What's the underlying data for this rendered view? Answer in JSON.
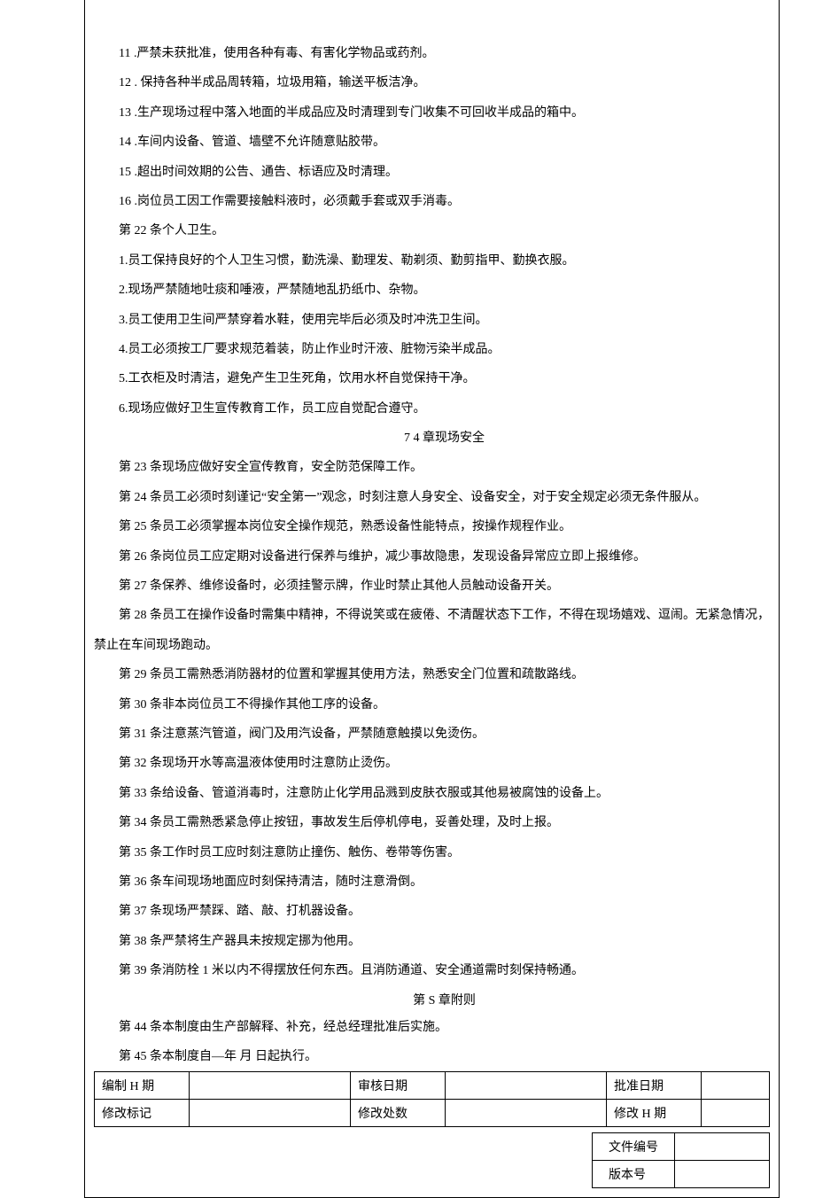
{
  "lines": {
    "l11": "11 .严禁未获批准，使用各种有毒、有害化学物品或药剂。",
    "l12": "12 . 保持各种半成品周转箱，垃圾用箱，输送平板洁净。",
    "l13": "13 .生产现场过程中落入地面的半成品应及时清理到专门收集不可回收半成品的箱中。",
    "l14": "14 .车间内设备、管道、墙壁不允许随意贴胶带。",
    "l15": "15 .超出时间效期的公告、通告、标语应及时清理。",
    "l16": "16 .岗位员工因工作需要接触料液时，必须戴手套或双手消毒。",
    "a22": "第 22 条个人卫生。",
    "p1": "1.员工保持良好的个人卫生习惯，勤洗澡、勤理发、勒剃须、勤剪指甲、勤换衣服。",
    "p2": "2.现场严禁随地吐痰和唾液，严禁随地乱扔纸巾、杂物。",
    "p3": "3.员工使用卫生间严禁穿着水鞋，使用完毕后必须及时冲洗卫生间。",
    "p4": "4.员工必须按工厂要求规范着装，防止作业时汗液、脏物污染半成品。",
    "p5": "5.工衣柜及时清洁，避免产生卫生死角，饮用水杯自觉保持干净。",
    "p6": "6.现场应做好卫生宣传教育工作，员工应自觉配合遵守。",
    "h4": "7  4 章现场安全",
    "a23": "第 23 条现场应做好安全宣传教育，安全防范保障工作。",
    "a24": "第 24 条员工必须时刻谨记“安全第一”观念，时刻注意人身安全、设备安全，对于安全规定必须无条件服从。",
    "a25": "第 25 条员工必须掌握本岗位安全操作规范，熟悉设备性能特点，按操作规程作业。",
    "a26": "第 26 条岗位员工应定期对设备进行保养与维护，减少事故隐患，发现设备异常应立即上报维修。",
    "a27": "第 27 条保养、维修设备时，必须挂警示牌，作业时禁止其他人员触动设备开关。",
    "a28a": "第 28 条员工在操作设备时需集中精神，不得说笑或在疲倦、不清醒状态下工作，不得在现场嬉戏、逗闹。无紧急情况，",
    "a28b": "禁止在车间现场跑动。",
    "a29": "第 29 条员工需熟悉消防器材的位置和掌握其使用方法，熟悉安全门位置和疏散路线。",
    "a30": "第 30 条非本岗位员工不得操作其他工序的设备。",
    "a31": "第 31 条注意蒸汽管道，阀门及用汽设备，严禁随意触摸以免烫伤。",
    "a32": "第 32 条现场开水等高温液体使用时注意防止烫伤。",
    "a33": "第 33 条给设备、管道消毒时，注意防止化学用品溅到皮肤衣服或其他易被腐蚀的设备上。",
    "a34": "第 34 条员工需熟悉紧急停止按钮，事故发生后停机停电，妥善处理，及时上报。",
    "a35": "第 35 条工作时员工应时刻注意防止撞伤、触伤、卷带等伤害。",
    "a36": "第 36 条车间现场地面应时刻保持清洁，随时注意滑倒。",
    "a37": "第 37 条现场严禁踩、踏、敲、打机器设备。",
    "a38": "第 38 条严禁将生产器具未按规定挪为他用。",
    "a39": "第 39 条消防栓 1 米以内不得摆放任何东西。且消防通道、安全通道需时刻保持畅通。",
    "hS": "第 S 章附则",
    "a44": "第 44 条本制度由生产部解释、补充，经总经理批准后实施。",
    "a45": "第 45 条本制度自—年  月  日起执行。"
  },
  "table1": {
    "r1c1": "编制 H 期",
    "r1c2": "",
    "r1c3": "审核日期",
    "r1c4": "",
    "r1c5": "批准日期",
    "r1c6": "",
    "r2c1": "修改标记",
    "r2c2": "",
    "r2c3": "修改处数",
    "r2c4": "",
    "r2c5": "修改 H 期",
    "r2c6": ""
  },
  "table2": {
    "r1c1": "文件编号",
    "r1c2": "",
    "r2c1": "版本号",
    "r2c2": ""
  },
  "chart_data": {
    "type": "table",
    "tables": [
      {
        "rows": [
          [
            "编制 H 期",
            "",
            "审核日期",
            "",
            "批准日期",
            ""
          ],
          [
            "修改标记",
            "",
            "修改处数",
            "",
            "修改 H 期",
            ""
          ]
        ]
      },
      {
        "rows": [
          [
            "文件编号",
            ""
          ],
          [
            "版本号",
            ""
          ]
        ]
      }
    ]
  }
}
